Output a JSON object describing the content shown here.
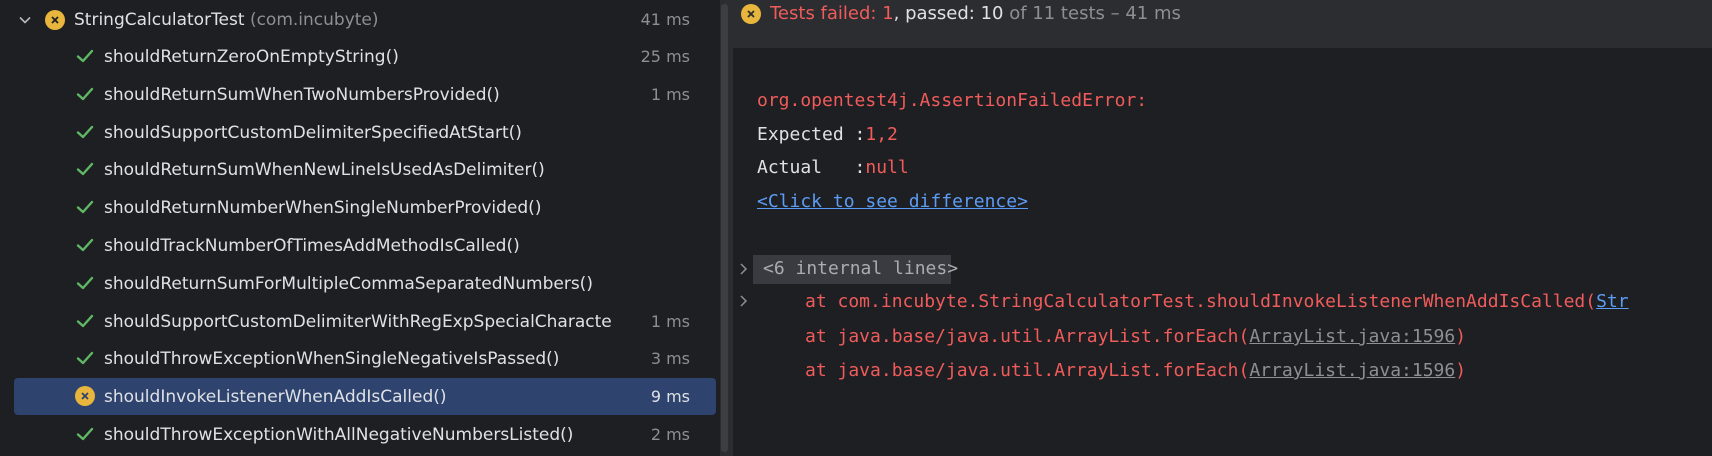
{
  "tree": {
    "root": {
      "name": "StringCalculatorTest",
      "package": "(com.incubyte)",
      "time": "41 ms"
    },
    "tests": [
      {
        "name": "shouldReturnZeroOnEmptyString()",
        "time": "25 ms",
        "status": "passed"
      },
      {
        "name": "shouldReturnSumWhenTwoNumbersProvided()",
        "time": "1 ms",
        "status": "passed"
      },
      {
        "name": "shouldSupportCustomDelimiterSpecifiedAtStart()",
        "time": "",
        "status": "passed"
      },
      {
        "name": "shouldReturnSumWhenNewLineIsUsedAsDelimiter()",
        "time": "",
        "status": "passed"
      },
      {
        "name": "shouldReturnNumberWhenSingleNumberProvided()",
        "time": "",
        "status": "passed"
      },
      {
        "name": "shouldTrackNumberOfTimesAddMethodIsCalled()",
        "time": "",
        "status": "passed"
      },
      {
        "name": "shouldReturnSumForMultipleCommaSeparatedNumbers()",
        "time": "",
        "status": "passed"
      },
      {
        "name": "shouldSupportCustomDelimiterWithRegExpSpecialCharacte",
        "time": "1 ms",
        "status": "passed"
      },
      {
        "name": "shouldThrowExceptionWhenSingleNegativeIsPassed()",
        "time": "3 ms",
        "status": "passed"
      },
      {
        "name": "shouldInvokeListenerWhenAddIsCalled()",
        "time": "9 ms",
        "status": "failed"
      },
      {
        "name": "shouldThrowExceptionWithAllNegativeNumbersListed()",
        "time": "2 ms",
        "status": "passed"
      }
    ]
  },
  "summary": {
    "failed_label": "Tests failed: 1",
    "passed_label": ", passed: 10",
    "total_label": " of 11 tests – 41 ms"
  },
  "output": {
    "error_class": "org.opentest4j.AssertionFailedError:",
    "expected_label": "Expected :",
    "expected_value": "1,2",
    "actual_label": "Actual   :",
    "actual_value": "null",
    "diff_link": "<Click to see difference>",
    "internal_lines": "<6 internal lines>",
    "trace": [
      {
        "prefix": "at com.incubyte.StringCalculatorTest.shouldInvokeListenerWhenAddIsCalled(",
        "link": "Str",
        "suffix": ""
      },
      {
        "prefix": "at java.base/java.util.ArrayList.forEach(",
        "link": "ArrayList.java:1596",
        "suffix": ")"
      },
      {
        "prefix": "at java.base/java.util.ArrayList.forEach(",
        "link": "ArrayList.java:1596",
        "suffix": ")"
      }
    ]
  },
  "colors": {
    "failed": "#f05b5b",
    "passed_check": "#5fb865",
    "warn_icon": "#e8b53d",
    "selection": "#2e436e",
    "link": "#5c9cf5"
  }
}
